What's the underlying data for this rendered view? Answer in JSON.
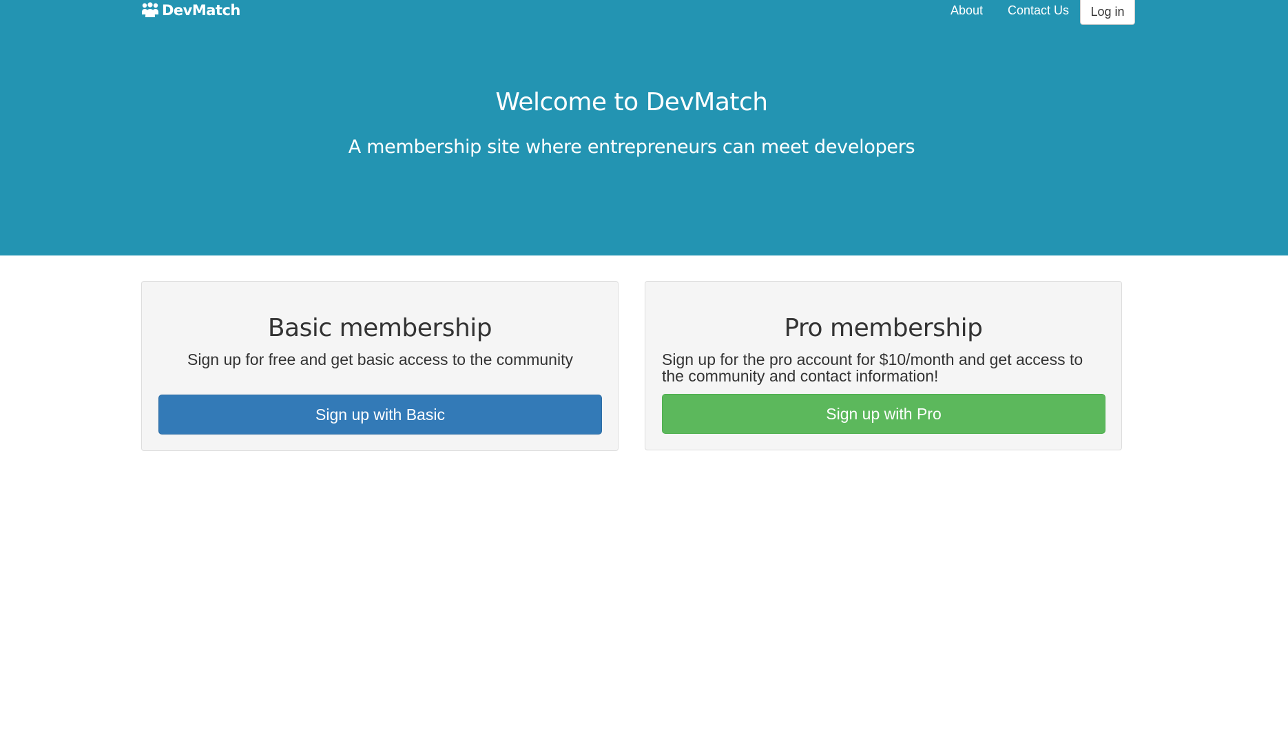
{
  "navbar": {
    "brand": "DevMatch",
    "brand_icon": "users-icon",
    "links": [
      {
        "label": "About"
      },
      {
        "label": "Contact Us"
      }
    ],
    "login_label": "Log in"
  },
  "hero": {
    "title": "Welcome to DevMatch",
    "subtitle": "A membership site where entrepreneurs can meet developers",
    "background_color": "#2394b2"
  },
  "plans": {
    "basic": {
      "title": "Basic membership",
      "description": "Sign up for free and get basic access to the community",
      "button_label": "Sign up with Basic",
      "button_color": "#337ab7"
    },
    "pro": {
      "title": "Pro membership",
      "description": "Sign up for the pro account for $10/month and get access to the community and contact information!",
      "button_label": "Sign up with Pro",
      "button_color": "#5cb85c"
    }
  }
}
